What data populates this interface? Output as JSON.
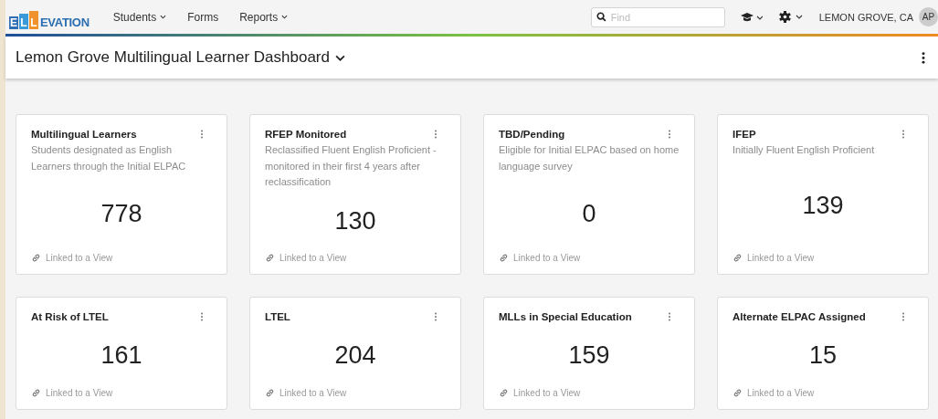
{
  "logo": {
    "boxed": [
      {
        "letter": "E",
        "color": "#2f6db5"
      },
      {
        "letter": "L",
        "color": "#3a9ad9"
      },
      {
        "letter": "L",
        "color": "#f0922b"
      }
    ],
    "rest": "EVATION"
  },
  "nav": [
    {
      "label": "Students",
      "has_menu": true
    },
    {
      "label": "Forms",
      "has_menu": false
    },
    {
      "label": "Reports",
      "has_menu": true
    }
  ],
  "search": {
    "placeholder": "Find"
  },
  "district": "LEMON GROVE, CA",
  "avatar": "AP",
  "page_title": "Lemon Grove Multilingual Learner Dashboard",
  "cards": [
    {
      "title": "Multilingual Learners",
      "description": "Students designated as English Learners through the Initial ELPAC",
      "count": "778",
      "link": "Linked to a View"
    },
    {
      "title": "RFEP Monitored",
      "description": "Reclassified Fluent English Proficient - monitored in their first 4 years after reclassification",
      "count": "130",
      "link": "Linked to a View"
    },
    {
      "title": "TBD/Pending",
      "description": "Eligible for Initial ELPAC based on home language survey",
      "count": "0",
      "link": "Linked to a View"
    },
    {
      "title": "IFEP",
      "description": "Initially Fluent English Proficient",
      "count": "139",
      "link": "Linked to a View"
    },
    {
      "title": "At Risk of LTEL",
      "count": "161",
      "link": "Linked to a View"
    },
    {
      "title": "LTEL",
      "count": "204",
      "link": "Linked to a View"
    },
    {
      "title": "MLLs in Special Education",
      "count": "159",
      "link": "Linked to a View"
    },
    {
      "title": "Alternate ELPAC Assigned",
      "count": "15",
      "link": "Linked to a View"
    }
  ]
}
